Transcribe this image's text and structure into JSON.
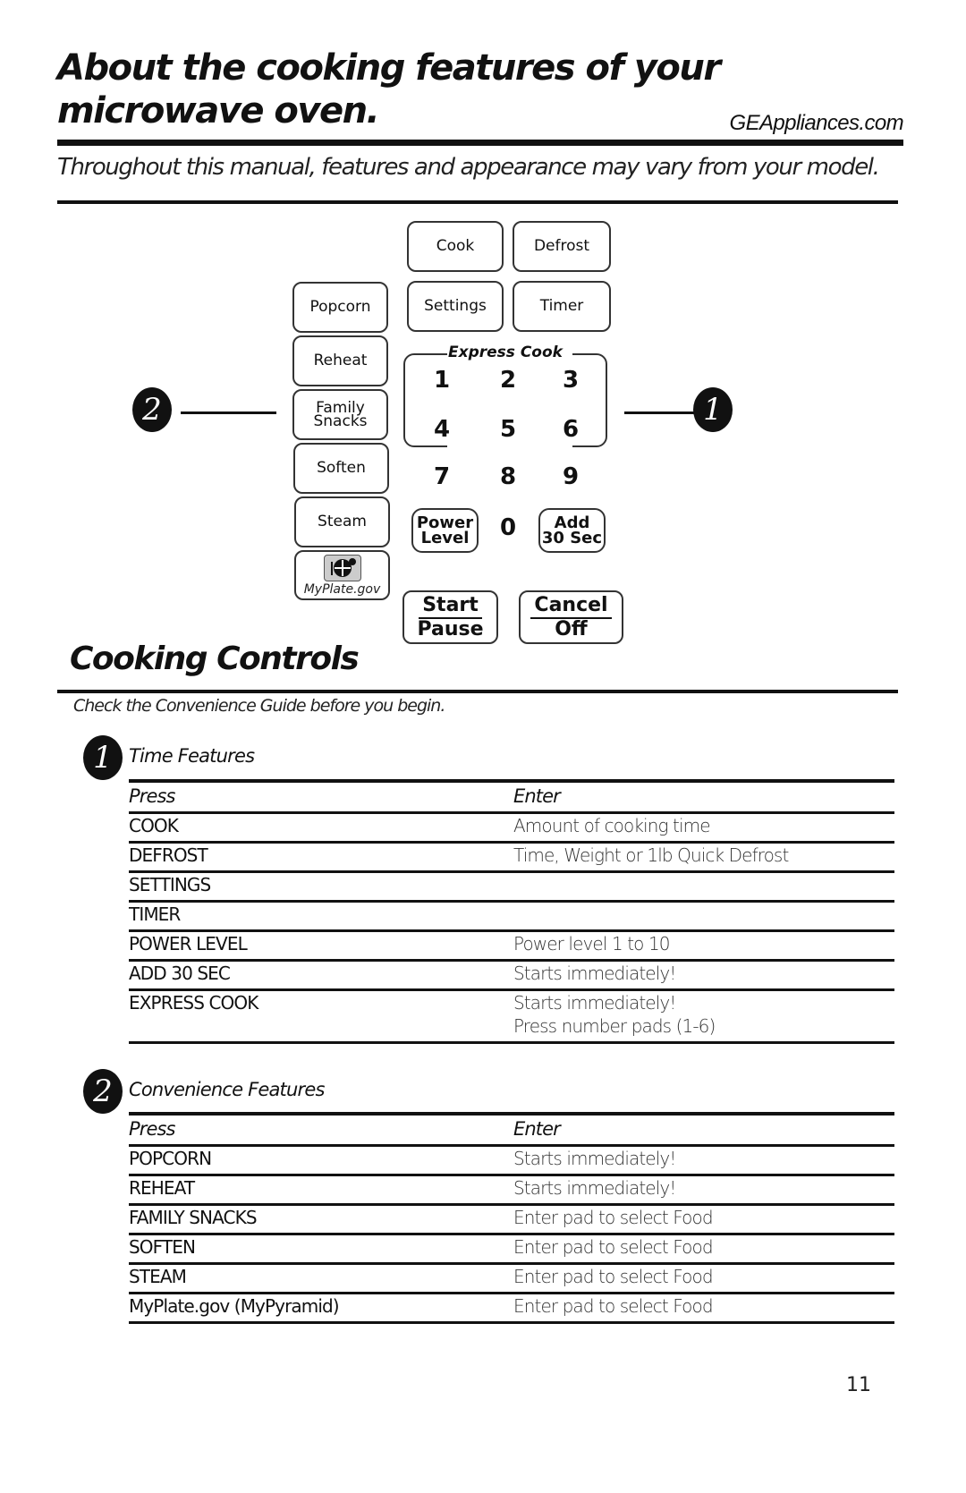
{
  "header": {
    "title_line1": "About the cooking features of your",
    "title_line2": "microwave oven.",
    "website": "GEAppliances.com",
    "subtitle": "Throughout this manual, features and appearance may vary from your model."
  },
  "control_panel": {
    "top_keys": [
      "Cook",
      "Defrost",
      "Settings",
      "Timer"
    ],
    "left_keys": [
      "Popcorn",
      "Reheat",
      "Family\nSnacks",
      "Soften",
      "Steam"
    ],
    "family_line1": "Family",
    "family_line2": "Snacks",
    "myplate_label": "MyPlate.gov",
    "express_cook_label": "Express Cook",
    "digits": [
      "1",
      "2",
      "3",
      "4",
      "5",
      "6",
      "7",
      "8",
      "9",
      "0"
    ],
    "power_level_line1": "Power",
    "power_level_line2": "Level",
    "add30_line1": "Add",
    "add30_line2": "30 Sec",
    "start_line1": "Start",
    "start_line2": "Pause",
    "cancel_line1": "Cancel",
    "cancel_line2": "Off",
    "callout_left": "2",
    "callout_right": "1"
  },
  "cooking_controls": {
    "heading": "Cooking Controls",
    "note": "Check the Convenience Guide before you begin.",
    "time_features": {
      "marker": "1",
      "title": "Time Features",
      "col_press": "Press",
      "col_enter": "Enter",
      "rows": [
        {
          "press": "COOK",
          "enter": "Amount of cooking time"
        },
        {
          "press": "DEFROST",
          "enter": "Time, Weight or 1lb Quick Defrost"
        },
        {
          "press": "SETTINGS",
          "enter": ""
        },
        {
          "press": "TIMER",
          "enter": ""
        },
        {
          "press": "POWER LEVEL",
          "enter": "Power level 1 to 10"
        },
        {
          "press": "ADD 30 SEC",
          "enter": "Starts immediately!"
        },
        {
          "press": "EXPRESS COOK",
          "enter": "Starts immediately!",
          "enter2": "Press number pads (1-6)"
        }
      ]
    },
    "convenience_features": {
      "marker": "2",
      "title": "Convenience Features",
      "col_press": "Press",
      "col_enter": "Enter",
      "rows": [
        {
          "press": "POPCORN",
          "enter": "Starts immediately!"
        },
        {
          "press": "REHEAT",
          "enter": "Starts immediately!"
        },
        {
          "press": "FAMILY SNACKS",
          "enter": "Enter pad to select Food"
        },
        {
          "press": "SOFTEN",
          "enter": "Enter pad to select Food"
        },
        {
          "press": "STEAM",
          "enter": "Enter pad to select Food"
        },
        {
          "press": "MyPlate.gov (MyPyramid)",
          "enter": "Enter pad to select Food"
        }
      ]
    }
  },
  "page_number": "11"
}
